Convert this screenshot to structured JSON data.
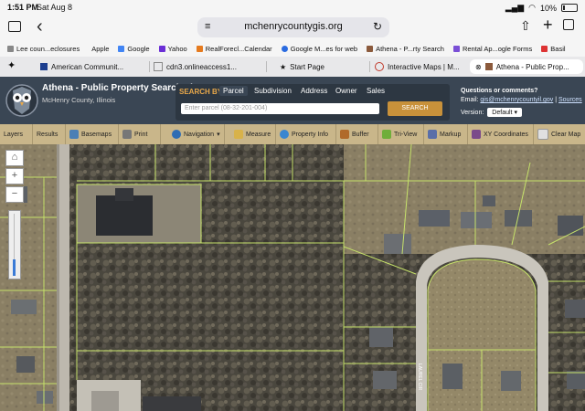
{
  "status": {
    "time": "1:51 PM",
    "date": "Sat Aug 8",
    "battery": "10%"
  },
  "browser": {
    "url": "mchenrycountygis.org",
    "bookmarks": [
      "Lee coun...eclosures",
      "Apple",
      "Google",
      "Yahoo",
      "RealForecl...Calendar",
      "Google M...es for web",
      "Athena - P...rty Search",
      "Rental Ap...ogle Forms",
      "Basil"
    ],
    "tabs": [
      "American Communit...",
      "cdn3.onlineaccess1...",
      "Start Page",
      "Interactive Maps | M...",
      "Athena - Public Prop..."
    ]
  },
  "athena": {
    "title": "Athena - Public Property Search Viewer",
    "subtitle": "McHenry County, Illinois",
    "search_by": "SEARCH BY:",
    "tabs": [
      "Parcel",
      "Subdivision",
      "Address",
      "Owner",
      "Sales"
    ],
    "placeholder": "Enter parcel (08-32-201-004)",
    "search_button": "SEARCH",
    "questions": "Questions or comments?",
    "email_label": "Email:",
    "email": "gis@mchenrycountyil.gov",
    "sources": "Sources",
    "version_label": "Version:",
    "version": "Default"
  },
  "tools": [
    "Layers",
    "Results",
    "Basemaps",
    "Print",
    "Navigation",
    "Measure",
    "Property Info",
    "Buffer",
    "Tri-View",
    "Markup",
    "XY Coordinates",
    "Clear Map"
  ],
  "map": {
    "road_label": "LAUREL CIR",
    "zoom_level": 0.25
  }
}
